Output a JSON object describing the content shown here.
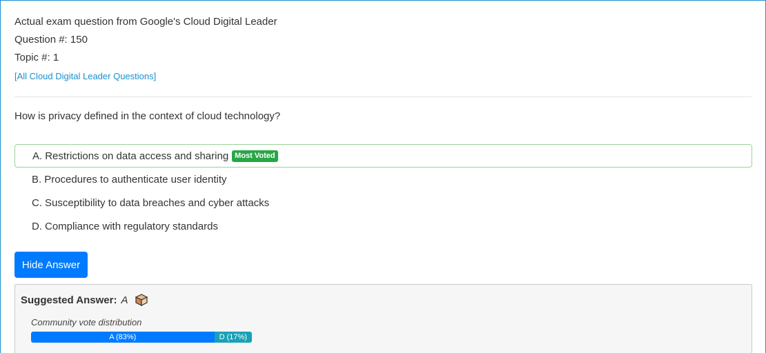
{
  "header": {
    "exam_line": "Actual exam question from Google's Cloud Digital Leader",
    "question_number": "Question #: 150",
    "topic_number": "Topic #: 1",
    "all_questions_link": "[All Cloud Digital Leader Questions]"
  },
  "question": {
    "text": "How is privacy defined in the context of cloud technology?"
  },
  "choices": [
    {
      "letter": "A.",
      "text": "Restrictions on data access and sharing",
      "badge": "Most Voted"
    },
    {
      "letter": "B.",
      "text": "Procedures to authenticate user identity"
    },
    {
      "letter": "C.",
      "text": "Susceptibility to data breaches and cyber attacks"
    },
    {
      "letter": "D.",
      "text": "Compliance with regulatory standards"
    }
  ],
  "hide_answer_button": "Hide Answer",
  "answer": {
    "label": "Suggested Answer:",
    "value": "A",
    "icon": "box-icon",
    "vote_label": "Community vote distribution",
    "votes": [
      {
        "label": "A (83%)",
        "percent": 83,
        "color": "#007bff"
      },
      {
        "label": "D (17%)",
        "percent": 17,
        "color": "#17a2b8"
      }
    ]
  },
  "colors": {
    "accent": "#007bff",
    "link": "#1a8fd0",
    "correct_border": "#9ad39a",
    "badge": "#28a745"
  }
}
